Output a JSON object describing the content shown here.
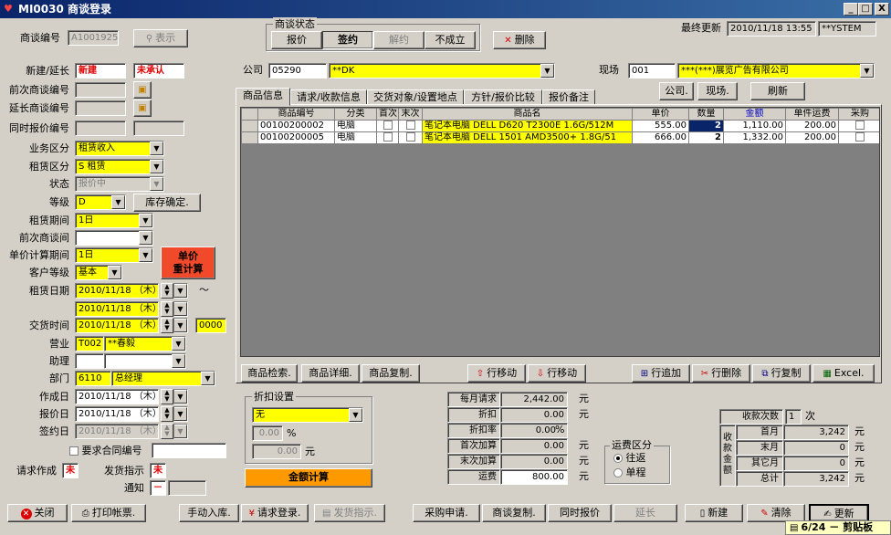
{
  "window": {
    "app_icon": "♥",
    "title": "MI0030 商谈登录",
    "min": "_",
    "max": "□",
    "close": "X"
  },
  "header": {
    "deal_no_label": "商谈编号",
    "deal_no": "A1001925",
    "display_btn": "表示",
    "status_group_title": "商谈状态",
    "status_buttons": [
      "报价",
      "签约",
      "解约",
      "不成立"
    ],
    "delete_btn": "删除",
    "last_update_label": "最终更新",
    "last_update_value": "2010/11/18 13:55",
    "last_update_user": "**YSTEM"
  },
  "left": {
    "new_ext_label": "新建/延长",
    "new_ext_value": "新建",
    "unapproved": "未承认",
    "prev_deal_label": "前次商谈编号",
    "ext_deal_label": "延长商谈编号",
    "same_quote_label": "同时报价编号",
    "biz_class_label": "业务区分",
    "biz_class": "租赁收入",
    "lease_class_label": "租赁区分",
    "lease_class": "S 租赁",
    "state_label": "状态",
    "state": "报价中",
    "grade_label": "等级",
    "grade": "D",
    "stock_btn": "库存确定.",
    "lease_period_label": "租赁期间",
    "lease_period": "1日",
    "prev_period_label": "前次商谈间",
    "prev_period": "",
    "unit_period_label": "单价计算期间",
    "unit_period": "1日",
    "recalc_btn": "单价\n重计算",
    "cust_grade_label": "客户等级",
    "cust_grade": "基本",
    "lease_date_label": "租赁日期",
    "lease_date_from": "2010/11/18 （木）",
    "lease_date_to": "2010/11/18 （木）",
    "tilde": "〜",
    "delivery_label": "交货时间",
    "delivery_date": "2010/11/18 （木）",
    "delivery_time": "0000",
    "sales_label": "营业",
    "sales_code": "T002",
    "sales_name": "**春毅",
    "assist_label": "助理",
    "dept_label": "部门",
    "dept_code": "6110",
    "dept_name": "总经理",
    "created_label": "作成日",
    "created": "2010/11/18 （木）",
    "quoted_label": "报价日",
    "quoted": "2010/11/18 （木）",
    "signed_label": "签约日",
    "signed": "2010/11/18 （木）",
    "contract_label": "要求合同编号",
    "invoice_label": "请求作成",
    "invoice_value": "未",
    "dispatch_label": "发货指示",
    "dispatch_value": "未",
    "notice_label": "通知",
    "notice_value": "－"
  },
  "company": {
    "label": "公司",
    "code": "05290",
    "name": "**DK",
    "site_label": "现场",
    "site_code": "001",
    "site_name": "***(***)展览广告有限公司"
  },
  "tabs": [
    "商品信息",
    "请求/收款信息",
    "交货对象/设置地点",
    "方针/报价比较",
    "报价备注"
  ],
  "tab_buttons": {
    "company": "公司.",
    "site": "现场.",
    "refresh": "刷新"
  },
  "grid": {
    "headers": [
      "商品编号",
      "分类",
      "首次",
      "末次",
      "商品名",
      "单价",
      "数量",
      "金额",
      "单件运费",
      "采购"
    ],
    "rows": [
      {
        "code": "00100200002",
        "cat": "电脑",
        "name": "笔记本电脑  DELL  D620  T2300E  1.6G/512M",
        "price": "555.00",
        "qty": "2",
        "amount": "1,110.00",
        "ship": "200.00"
      },
      {
        "code": "00100200005",
        "cat": "电脑",
        "name": "笔记本电脑  DELL  1501  AMD3500+  1.8G/51",
        "price": "666.00",
        "qty": "2",
        "amount": "1,332.00",
        "ship": "200.00"
      }
    ]
  },
  "grid_buttons": {
    "search": "商品检索.",
    "detail": "商品详细.",
    "copy": "商品复制.",
    "move_up": "行移动",
    "move_down": "行移动",
    "add": "行追加",
    "del": "行删除",
    "rcopy": "行复制",
    "excel": "Excel."
  },
  "discount": {
    "title": "折扣设置",
    "type": "无",
    "pct": "0.00",
    "pct_unit": "%",
    "amount": "0.00",
    "amount_unit": "元",
    "calc_btn": "金额计算"
  },
  "summary": {
    "rows": [
      {
        "label": "每月请求",
        "value": "2,442.00",
        "unit": "元"
      },
      {
        "label": "折扣",
        "value": "0.00",
        "unit": "元"
      },
      {
        "label": "折扣率",
        "value": "0.00",
        "unit": "%"
      },
      {
        "label": "首次加算",
        "value": "0.00",
        "unit": "元"
      },
      {
        "label": "末次加算",
        "value": "0.00",
        "unit": "元"
      },
      {
        "label": "运费",
        "value": "800.00",
        "unit": "元"
      }
    ]
  },
  "shipping": {
    "title": "运费区分",
    "opt1": "往返",
    "opt2": "单程"
  },
  "receipt": {
    "count_label": "收款次数",
    "count": "1",
    "count_unit": "次",
    "side_label": "收款金额",
    "rows": [
      {
        "label": "首月",
        "value": "3,242",
        "unit": "元"
      },
      {
        "label": "末月",
        "value": "0",
        "unit": "元"
      },
      {
        "label": "其它月",
        "value": "0",
        "unit": "元"
      },
      {
        "label": "总计",
        "value": "3,242",
        "unit": "元"
      }
    ]
  },
  "footer": {
    "close": "关闭",
    "print": "打印帐票.",
    "manual": "手动入库.",
    "invoice": "请求登录.",
    "dispatch": "发货指示.",
    "purchase": "采购申请.",
    "dealcopy": "商谈复制.",
    "samequote": "同时报价",
    "extend": "延长",
    "new": "新建",
    "clear": "清除",
    "update": "更新",
    "clipboard": "6/24 － 剪贴板"
  }
}
